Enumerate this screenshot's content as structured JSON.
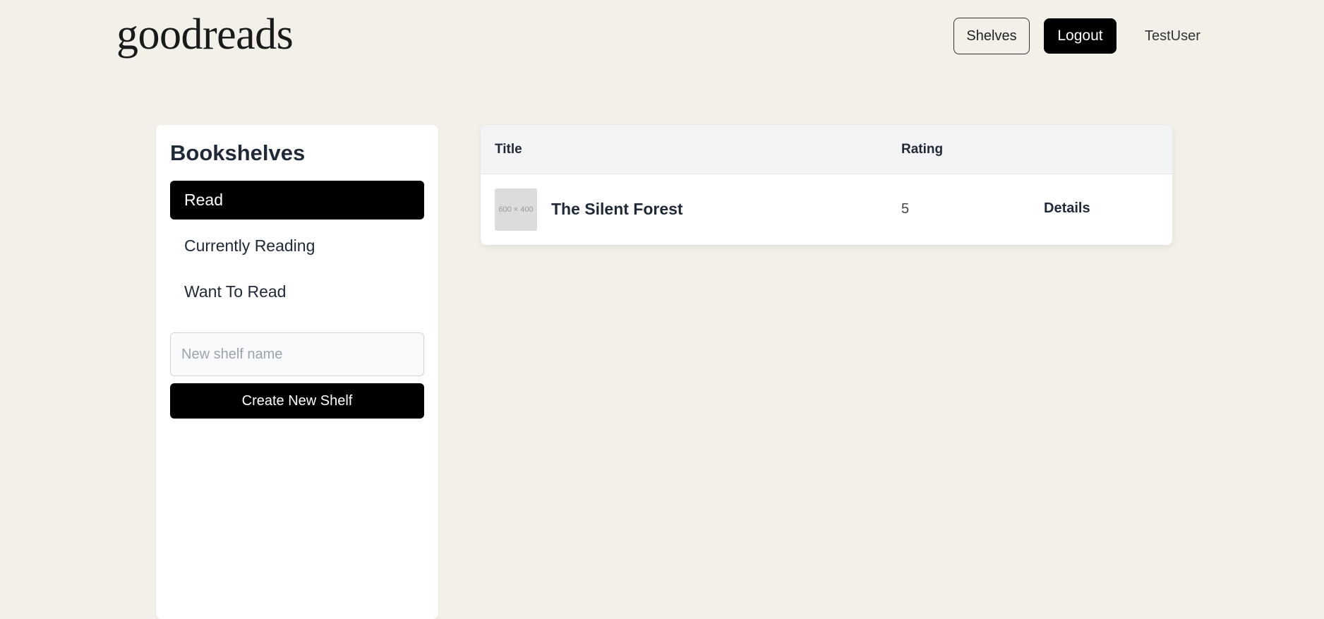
{
  "header": {
    "logo": "goodreads",
    "shelves_label": "Shelves",
    "logout_label": "Logout",
    "username": "TestUser"
  },
  "sidebar": {
    "title": "Bookshelves",
    "items": [
      {
        "label": "Read",
        "active": true
      },
      {
        "label": "Currently Reading",
        "active": false
      },
      {
        "label": "Want To Read",
        "active": false
      }
    ],
    "new_shelf_placeholder": "New shelf name",
    "new_shelf_value": "",
    "create_label": "Create New Shelf"
  },
  "table": {
    "columns": [
      "Title",
      "Rating"
    ],
    "rows": [
      {
        "thumbnail_text": "600 × 400",
        "title": "The Silent Forest",
        "rating": "5",
        "action": "Details"
      }
    ]
  },
  "colors": {
    "background": "#f3f0e9",
    "accent": "#000000",
    "card": "#ffffff"
  }
}
